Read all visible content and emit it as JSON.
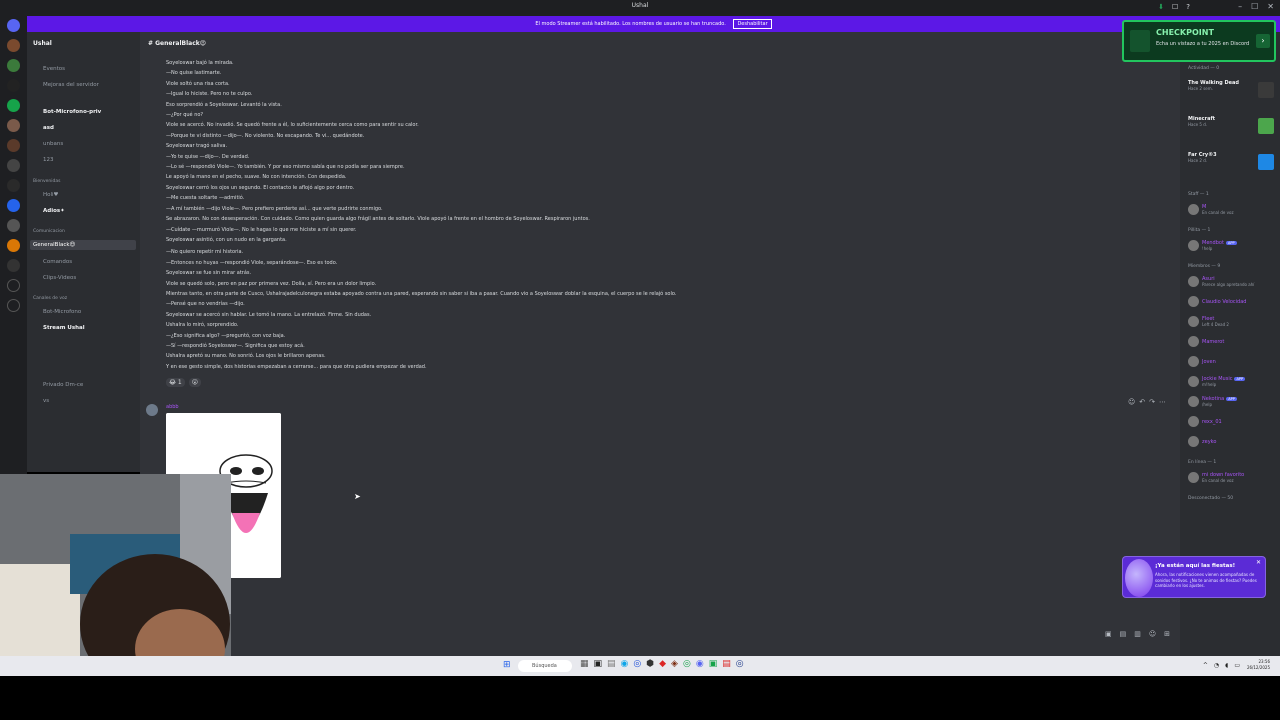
{
  "window": {
    "title": "Ushal"
  },
  "streamer_bar": {
    "text": "El modo Streamer está habilitado. Los nombres de usuario se han truncado.",
    "button": "Deshabilitar"
  },
  "server": {
    "name": "Ushal"
  },
  "channels": [
    {
      "label": "Eventos",
      "type": "nav"
    },
    {
      "label": "Mejoras del servidor",
      "type": "nav"
    },
    {
      "label": "Bot-Microfono-priv",
      "type": "bold"
    },
    {
      "label": "asd",
      "type": "bold"
    },
    {
      "label": "unbans",
      "type": "normal"
    },
    {
      "label": "123",
      "type": "normal"
    },
    {
      "label": "Bienvenidas",
      "type": "cat"
    },
    {
      "label": "Holi♥",
      "type": "normal"
    },
    {
      "label": "Adios✦",
      "type": "bold"
    },
    {
      "label": "Comunicacion",
      "type": "cat"
    },
    {
      "label": "GeneralBlack😍",
      "type": "active"
    },
    {
      "label": "Comandos",
      "type": "normal"
    },
    {
      "label": "Clips-Videos",
      "type": "normal"
    },
    {
      "label": "Canales de voz",
      "type": "cat"
    },
    {
      "label": "Bot-Microfono",
      "type": "normal"
    },
    {
      "label": "Stream Ushal",
      "type": "bold"
    },
    {
      "label": "Privado Dm-ce",
      "type": "normal"
    },
    {
      "label": "vs",
      "type": "normal"
    }
  ],
  "main": {
    "channel_title": "GeneralBlack😍",
    "lines": [
      "Soyeloswar bajó la mirada.",
      "—No quise lastimarte.",
      "Viole soltó una risa corta.",
      "—Igual lo hiciste. Pero no te culpo.",
      "Eso sorprendió a Soyeloswar. Levantó la vista.",
      "—¿Por qué no?",
      "Viole se acercó. No invadió. Se quedó frente a él, lo suficientemente cerca como para sentir su calor.",
      "—Porque te vi distinto —dijo—. No violento. No escapando. Te vi... quedándote.",
      "Soyeloswar tragó saliva.",
      "—Yo te quise —dijo—. De verdad.",
      "—Lo sé —respondió Viole—. Yo también. Y por eso mismo sabía que no podía ser para siempre.",
      "Le apoyó la mano en el pecho, suave. No con intención. Con despedida.",
      "Soyeloswar cerró los ojos un segundo. El contacto le aflojó algo por dentro.",
      "—Me cuesta soltarte —admitió.",
      "—A mí también —dijo Viole—. Pero prefiero perderte así... que verte pudrirte conmigo.",
      "Se abrazaron. No con desesperación. Con cuidado. Como quien guarda algo frágil antes de soltarlo. Viole apoyó la frente en el hombro de Soyeloswar. Respiraron juntos.",
      "—Cuídate —murmuró Viole—. No le hagas lo que me hiciste a mí sin querer.",
      "Soyeloswar asintió, con un nudo en la garganta.",
      "—No quiero repetir mi historia.",
      "—Entonces no huyas —respondió Viole, separándose—. Eso es todo.",
      "Soyeloswar se fue sin mirar atrás.",
      "Viole se quedó solo, pero en paz por primera vez. Dolía, sí. Pero era un dolor limpio.",
      "Mientras tanto, en otra parte de Cusco, Ushalrajadelculonegra estaba apoyado contra una pared, esperando sin saber si iba a pasar. Cuando vio a Soyeloswar doblar la esquina, el cuerpo se le relajó solo.",
      "—Pensé que no vendrías —dijo.",
      "Soyeloswar se acercó sin hablar. Le tomó la mano. La entrelazó. Firme. Sin dudas.",
      "Ushalra lo miró, sorprendido.",
      "—¿Eso significa algo? —preguntó, con voz baja.",
      "—Sí —respondió Soyeloswar—. Significa que estoy acá.",
      "Ushalra apretó su mano. No sonrió. Los ojos le brillaron apenas.",
      "Y en ese gesto simple, dos historias empezaban a cerrarse... para que otra pudiera empezar de verdad."
    ],
    "reactions": [
      "😂 1",
      "😮"
    ],
    "second_author": "abbb"
  },
  "checkpoint": {
    "title": "CHECKPOINT",
    "text": "Echa un vistazo a tu 2025 en Discord"
  },
  "members": {
    "activity_header": "Actividad — 0",
    "activities": [
      {
        "game": "The Walking Dead",
        "sub": "Hace 2 sem.",
        "color": "#3a3a3a"
      },
      {
        "game": "Minecraft",
        "sub": "Hace 5 d.",
        "color": "#4ca64c"
      },
      {
        "game": "Far Cry®3",
        "sub": "Hace 2 d.",
        "color": "#1e88e5"
      }
    ],
    "sections": [
      {
        "label": "Staff — 1",
        "members": [
          {
            "name": "M",
            "status": "En canal de voz"
          }
        ]
      },
      {
        "label": "Pillita — 1",
        "members": [
          {
            "name": "Mendbot",
            "status": "!help",
            "badge": "APP"
          }
        ]
      },
      {
        "label": "Miembros — 9",
        "members": [
          {
            "name": "Asuri",
            "status": "Parece algo apretando ahí"
          },
          {
            "name": "Claudio Velocidad",
            "status": ""
          },
          {
            "name": "Fleet",
            "status": "Left 4 Dead 2"
          },
          {
            "name": "Mamerot",
            "status": ""
          },
          {
            "name": "Joven",
            "status": ""
          },
          {
            "name": "Jockie Music",
            "status": "m!help",
            "badge": "APP"
          },
          {
            "name": "Nekotina",
            "status": "/help",
            "badge": "APP"
          },
          {
            "name": "rexx_01",
            "status": ""
          },
          {
            "name": "zeyko",
            "status": ""
          }
        ]
      },
      {
        "label": "En línea — 1",
        "members": [
          {
            "name": "mi down favorito",
            "status": "En canal de voz"
          }
        ]
      },
      {
        "label": "Desconectado — 50",
        "members": []
      }
    ]
  },
  "promo": {
    "title": "¡Ya están aquí las fiestas!",
    "text": "Ahora, las notificaciones vienen acompañadas de sonidos festivos. ¿No te animas de fiestas? Puedes cambiarlo en los ajustes."
  },
  "taskbar": {
    "search": "Búsqueda",
    "time": "23:56",
    "date": "26/12/2025"
  }
}
